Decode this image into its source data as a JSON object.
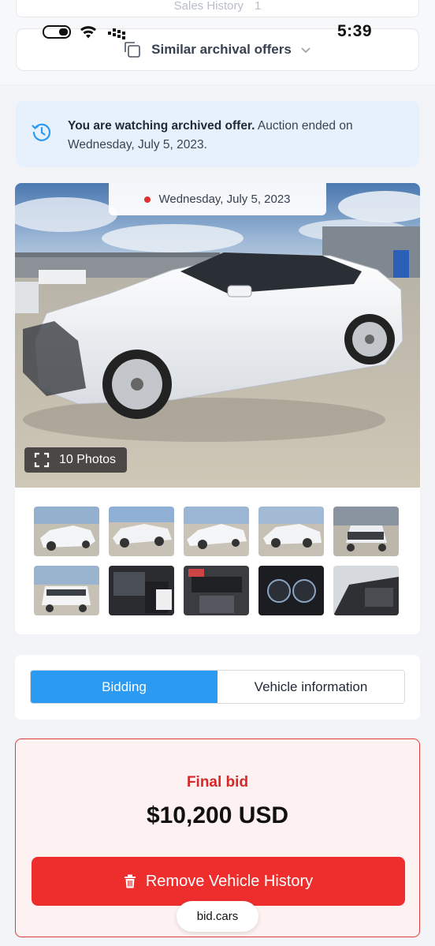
{
  "status_bar": {
    "time": "5:39"
  },
  "ghost_row": {
    "label": "Sales History",
    "count": "1"
  },
  "similar": {
    "label": "Similar archival offers"
  },
  "notice": {
    "bold": "You are watching archived offer.",
    "text": " Auction ended on Wednesday, July 5, 2023."
  },
  "gallery": {
    "date": "Wednesday, July 5, 2023",
    "photos_label": "10 Photos"
  },
  "tabs": [
    {
      "label": "Bidding",
      "active": true
    },
    {
      "label": "Vehicle information",
      "active": false
    }
  ],
  "bid": {
    "label": "Final bid",
    "amount": "$10,200 USD",
    "remove_label": "Remove Vehicle History"
  },
  "browser": {
    "site": "bid.cars"
  },
  "colors": {
    "accent": "#2b9af3",
    "danger": "#ee2d2d",
    "notice_bg": "#e6f1fd"
  }
}
